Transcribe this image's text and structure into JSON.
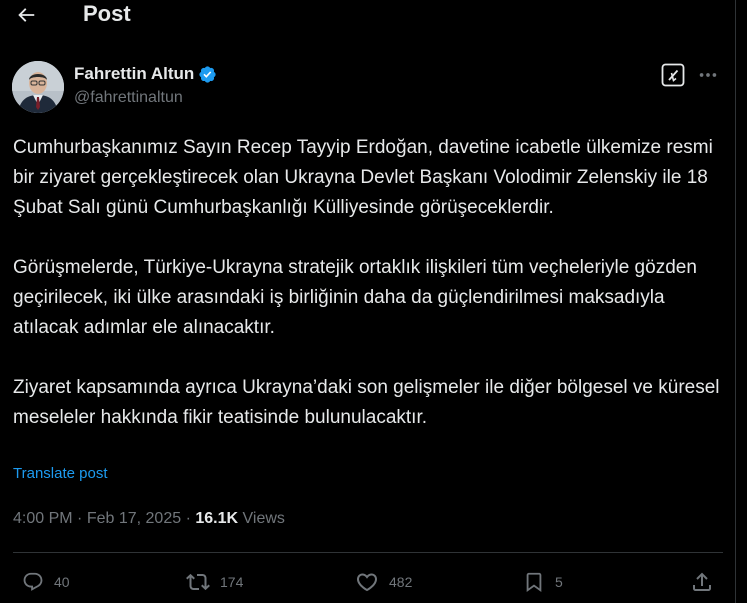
{
  "header": {
    "title": "Post"
  },
  "author": {
    "name": "Fahrettin Altun",
    "handle": "@fahrettinaltun",
    "verified_color": "#1d9bf0"
  },
  "post": {
    "paragraphs": [
      "Cumhurbaşkanımız Sayın Recep Tayyip Erdoğan, davetine icabetle ülkemize resmi bir ziyaret gerçekleştirecek olan Ukrayna Devlet Başkanı Volodimir Zelenskiy ile 18 Şubat Salı günü Cumhurbaşkanlığı Külliyesinde görüşeceklerdir.",
      "Görüşmelerde, Türkiye-Ukrayna stratejik ortaklık ilişkileri tüm veçheleriyle gözden geçirilecek, iki ülke arasındaki iş birliğinin daha da güçlendirilmesi maksadıyla atılacak adımlar ele alınacaktır.",
      "Ziyaret kapsamında ayrıca Ukrayna’daki son gelişmeler ile diğer bölgesel ve küresel meseleler hakkında fikir teatisinde bulunulacaktır."
    ],
    "translate_label": "Translate post"
  },
  "meta": {
    "time": "4:00 PM",
    "separator": "·",
    "date": "Feb 17, 2025",
    "views_count": "16.1K",
    "views_label": "Views"
  },
  "actions": {
    "replies": "40",
    "reposts": "174",
    "likes": "482",
    "bookmarks": "5"
  },
  "colors": {
    "background": "#000000",
    "text": "#e7e9ea",
    "muted": "#71767b",
    "accent": "#1d9bf0",
    "border": "#2f3336"
  },
  "icons": {
    "back": "arrow-left-icon",
    "grok": "grok-icon",
    "more": "more-horizontal-icon",
    "reply": "reply-icon",
    "repost": "repost-icon",
    "like": "heart-icon",
    "bookmark": "bookmark-icon",
    "share": "share-icon"
  }
}
